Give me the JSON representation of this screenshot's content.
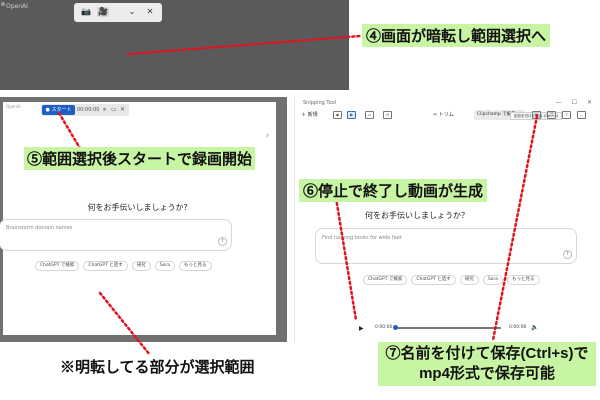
{
  "step4": {
    "window_title": "OpenAI",
    "toolbar_buttons": [
      "📷",
      "🎥",
      "⌄",
      "✕"
    ],
    "label": "④画面が暗転し範囲選択へ"
  },
  "step5": {
    "window_title": "OpenAI",
    "start_label": "スタート",
    "timer": "00:00:00",
    "question": "何をお手伝いしましょうか？",
    "input_placeholder": "Brainstorm domain names",
    "chips": [
      "ChatGPT で検索",
      "ChatGPT と話す",
      "研究",
      "Sora",
      "もっと見る"
    ],
    "label": "⑤範囲選択後スタートで録画開始",
    "footer_label": "※明転してる部分が選択範囲"
  },
  "step6": {
    "app_title": "Snipping Tool",
    "window_controls": "— ☐ ✕",
    "new_label": "＋ 新規",
    "trim_label": "✂ トリム",
    "clipchamp_label": "Clipchamp で編集…",
    "tooltip": "名前を付けて保存 (Ctrl+S)",
    "question": "何をお手伝いしましょうか？",
    "input_placeholder": "Find running boots for wide feet",
    "chips": [
      "ChatGPT で検索",
      "ChatGPT と話す",
      "研究",
      "Sora",
      "もっと見る"
    ],
    "time_start": "0:00:00",
    "time_end": "0:00:06",
    "playback_progress": 0,
    "label": "⑥停止で終了し動画が生成"
  },
  "step7": {
    "label_line1": "⑦名前を付けて保存(Ctrl+s)で",
    "label_line2": "mp4形式で保存可能"
  },
  "colors": {
    "label_bg": "#c8f5a4",
    "arrow": "#e0141e",
    "dim": "#5a5a5a",
    "accent": "#1f5fc4"
  }
}
